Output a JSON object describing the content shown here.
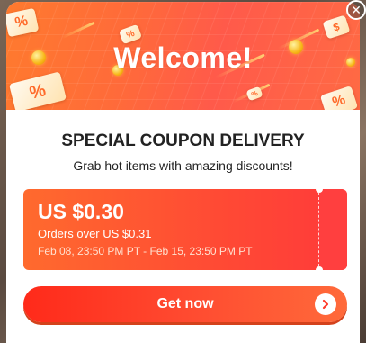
{
  "banner": {
    "welcome_text": "Welcome!",
    "tag_text": "%",
    "tag_text_dollar": "$",
    "colors": {
      "start": "#ff7a2e",
      "end": "#ff5a4a"
    }
  },
  "header": {
    "title": "SPECIAL COUPON DELIVERY",
    "subtitle": "Grab hot items with amazing discounts!"
  },
  "coupon": {
    "amount": "US $0.30",
    "min_order": "Orders over US $0.31",
    "validity": "Feb 08, 23:50 PM PT - Feb 15, 23:50 PM PT",
    "color": "#ff4a34"
  },
  "cta": {
    "label": "Get now",
    "icon": "chevron-right-icon"
  },
  "close": {
    "icon": "close-icon",
    "glyph": "✕"
  }
}
